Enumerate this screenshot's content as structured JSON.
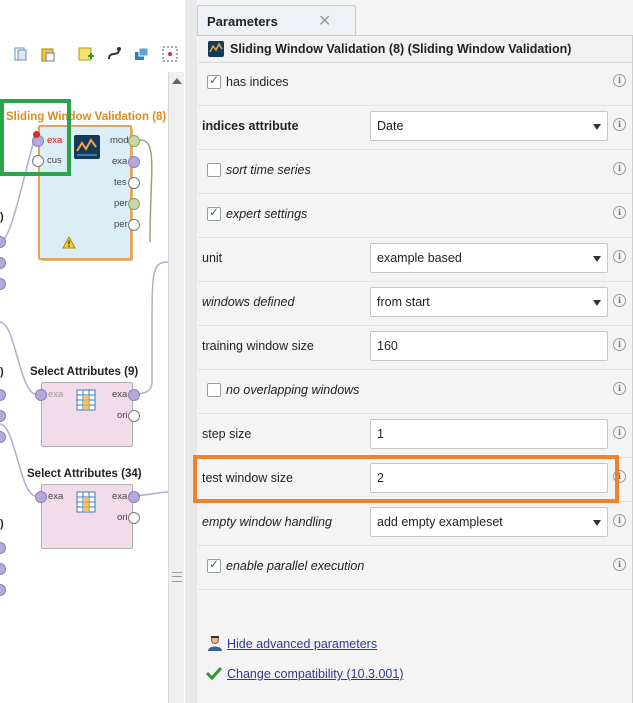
{
  "process": {
    "operators": [
      {
        "title": "Sliding Window Validation (8)",
        "in_ports": [
          "exa",
          "cus"
        ],
        "out_ports": [
          "mod",
          "exa",
          "tes",
          "per",
          "per"
        ]
      },
      {
        "title": "Select Attributes (9)",
        "in_ports": [
          "exa"
        ],
        "out_ports": [
          "exa",
          "ori"
        ]
      },
      {
        "title": "Select Attributes (34)",
        "in_ports": [
          "exa"
        ],
        "out_ports": [
          "exa",
          "ori"
        ]
      }
    ],
    "cut_labels": [
      ")",
      ")",
      ")"
    ]
  },
  "tab": {
    "title": "Parameters",
    "close": "✕"
  },
  "operator_header": "Sliding Window Validation (8) (Sliding Window Validation)",
  "params": {
    "has_indices": {
      "label": "has indices",
      "checked": true
    },
    "indices_attribute": {
      "label": "indices attribute",
      "value": "Date"
    },
    "sort_time_series": {
      "label": "sort time series",
      "checked": false
    },
    "expert_settings": {
      "label": "expert settings",
      "checked": true
    },
    "unit": {
      "label": "unit",
      "value": "example based"
    },
    "windows_defined": {
      "label": "windows defined",
      "value": "from start"
    },
    "training_window_size": {
      "label": "training window size",
      "value": "160"
    },
    "no_overlapping_windows": {
      "label": "no overlapping windows",
      "checked": false
    },
    "step_size": {
      "label": "step size",
      "value": "1"
    },
    "test_window_size": {
      "label": "test window size",
      "value": "2"
    },
    "empty_window_handling": {
      "label": "empty window handling",
      "value": "add empty exampleset"
    },
    "enable_parallel_execution": {
      "label": "enable parallel execution",
      "checked": true
    }
  },
  "links": {
    "hide_advanced": "Hide advanced parameters",
    "change_compat": "Change compatibility (10.3.001)"
  },
  "colors": {
    "highlight_orange": "#f0822a",
    "highlight_green": "#2aa548",
    "operator_blue": "#dbeef8",
    "operator_pink": "#f2dce9"
  }
}
